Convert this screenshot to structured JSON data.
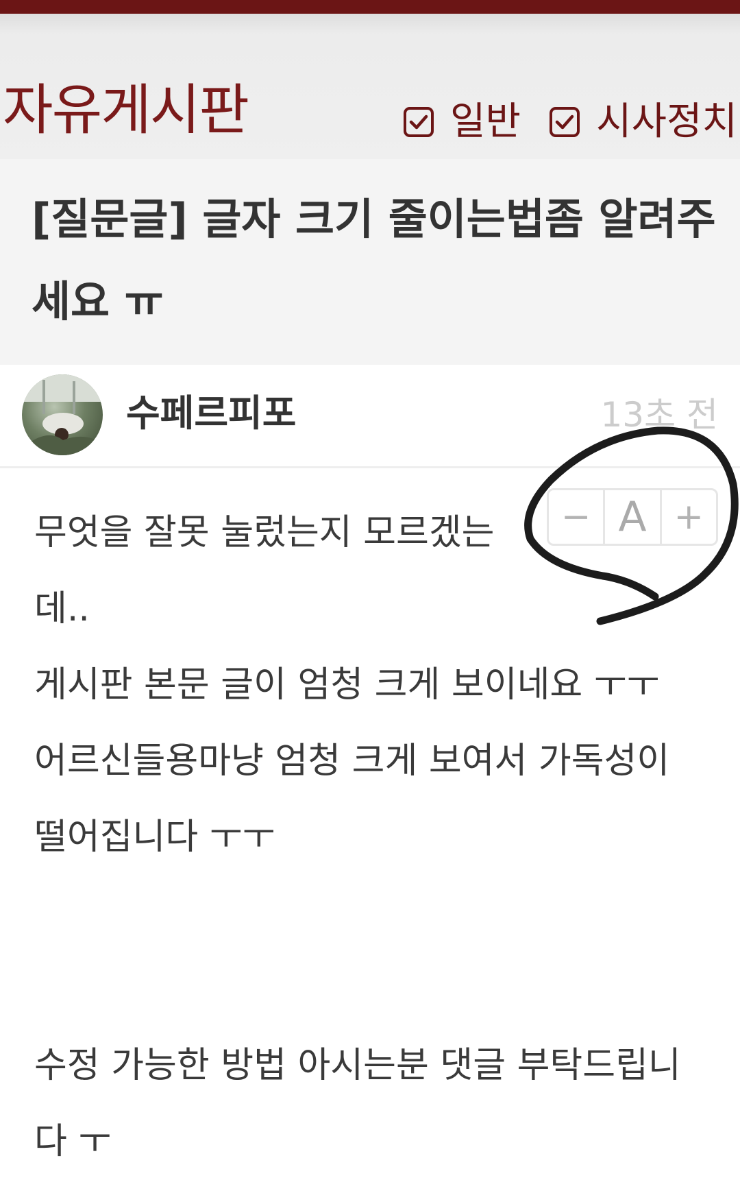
{
  "board": {
    "title": "자유게시판",
    "filters": [
      {
        "label": "일반",
        "checked": true
      },
      {
        "label": "시사정치",
        "checked": true
      }
    ]
  },
  "post": {
    "title": "[질문글] 글자 크기 줄이는법좀 알려주세요 ㅠ",
    "author": "수페르피포",
    "time": "13초 전",
    "body_lines_1": [
      "무엇을  잘못  눌렀는지  모르겠는",
      "데..",
      "게시판 본문 글이 엄청 크게 보이네요 ㅜㅜ",
      "어르신들용마냥 엄청 크게 보여서 가독성이",
      "떨어집니다 ㅜㅜ"
    ],
    "body_lines_2": [
      "수정 가능한 방법 아시는분 댓글 부탁드립니",
      "다 ㅜ"
    ]
  },
  "font_control": {
    "decrease": "−",
    "reset": "A",
    "increase": "+"
  },
  "colors": {
    "brand": "#6b1515",
    "title_text": "#333333",
    "time_text": "#cccccc"
  }
}
